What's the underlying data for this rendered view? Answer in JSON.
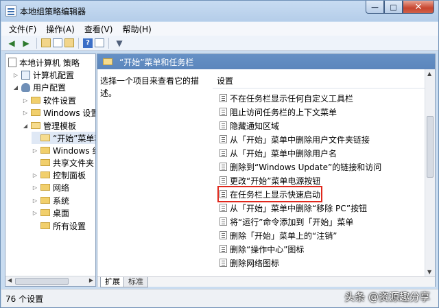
{
  "window": {
    "title": "本地组策略编辑器"
  },
  "caption": {
    "minimize": "—",
    "maximize": "□",
    "close": "✕"
  },
  "menu": [
    "文件(F)",
    "操作(A)",
    "查看(V)",
    "帮助(H)"
  ],
  "tree": {
    "items": [
      {
        "label": "本地计算机 策略",
        "level": 0,
        "icon": "doc-icon",
        "expander": ""
      },
      {
        "label": "计算机配置",
        "level": 1,
        "icon": "cfg-icon",
        "expander": "▷"
      },
      {
        "label": "用户配置",
        "level": 1,
        "icon": "user-icon",
        "expander": "◢"
      },
      {
        "label": "软件设置",
        "level": 2,
        "icon": "folder-icon",
        "expander": "▷"
      },
      {
        "label": "Windows 设置",
        "level": 2,
        "icon": "folder-icon",
        "expander": "▷"
      },
      {
        "label": "管理模板",
        "level": 2,
        "icon": "folder-open-icon",
        "expander": "◢"
      },
      {
        "label": "“开始”菜单和任务栏",
        "level": 3,
        "icon": "folder-open-icon",
        "expander": "",
        "selected": true
      },
      {
        "label": "Windows 组件",
        "level": 3,
        "icon": "folder-icon",
        "expander": "▷"
      },
      {
        "label": "共享文件夹",
        "level": 3,
        "icon": "folder-icon",
        "expander": ""
      },
      {
        "label": "控制面板",
        "level": 3,
        "icon": "folder-icon",
        "expander": "▷"
      },
      {
        "label": "网络",
        "level": 3,
        "icon": "folder-icon",
        "expander": "▷"
      },
      {
        "label": "系统",
        "level": 3,
        "icon": "folder-icon",
        "expander": "▷"
      },
      {
        "label": "桌面",
        "level": 3,
        "icon": "folder-icon",
        "expander": "▷"
      },
      {
        "label": "所有设置",
        "level": 3,
        "icon": "folder-icon",
        "expander": ""
      }
    ]
  },
  "right": {
    "header_title": "“开始”菜单和任务栏",
    "description": "选择一个项目来查看它的描述。",
    "column_header": "设置",
    "settings": [
      "不在任务栏显示任何自定义工具栏",
      "阻止访问任务栏的上下文菜单",
      "隐藏通知区域",
      "从「开始」菜单中删除用户文件夹链接",
      "从「开始」菜单中删除用户名",
      "删除到“Windows Update”的链接和访问",
      "更改“开始”菜单电源按钮",
      "在任务栏上显示快速启动",
      "从「开始」菜单中删除“移除 PC”按钮",
      "将“运行”命令添加到「开始」菜单",
      "删除「开始」菜单上的“注销”",
      "删除“操作中心”图标",
      "删除网络图标"
    ],
    "highlighted_index": 7,
    "tabs": [
      "扩展",
      "标准"
    ]
  },
  "status": {
    "text": "76 个设置"
  },
  "watermark": "头条 @资源趣分享"
}
